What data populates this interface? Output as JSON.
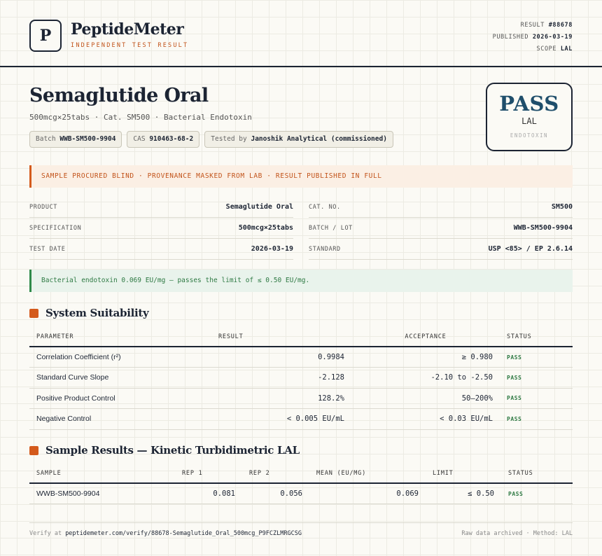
{
  "brand": {
    "logo_letter": "P",
    "name": "PeptideMeter",
    "tagline": "INDEPENDENT TEST RESULT"
  },
  "meta": {
    "result_label": "RESULT",
    "result_value": "#88678",
    "published_label": "PUBLISHED",
    "published_value": "2026-03-19",
    "scope_label": "SCOPE",
    "scope_value": "LAL"
  },
  "product": {
    "title": "Semaglutide Oral",
    "subtitle": "500mcg×25tabs · Cat. SM500 · Bacterial Endotoxin",
    "chips": [
      {
        "label": "Batch",
        "value": "WWB-SM500-9904"
      },
      {
        "label": "CAS",
        "value": "910463-68-2"
      },
      {
        "label": "Tested by",
        "value": "Janoshik Analytical (commissioned)"
      }
    ]
  },
  "verdict": {
    "main": "PASS",
    "sub": "LAL",
    "note": "ENDOTOXIN",
    "color": "#1f4e6b"
  },
  "banner": "SAMPLE PROCURED BLIND · PROVENANCE MASKED FROM LAB · RESULT PUBLISHED IN FULL",
  "specs": {
    "left": [
      {
        "key": "PRODUCT",
        "value": "Semaglutide Oral"
      },
      {
        "key": "SPECIFICATION",
        "value": "500mcg×25tabs"
      },
      {
        "key": "TEST DATE",
        "value": "2026-03-19"
      }
    ],
    "right": [
      {
        "key": "CAT. NO.",
        "value": "SM500"
      },
      {
        "key": "BATCH / LOT",
        "value": "WWB-SM500-9904"
      },
      {
        "key": "STANDARD",
        "value": "USP <85> / EP 2.6.14"
      }
    ]
  },
  "conclusion": "Bacterial endotoxin 0.069 EU/mg — passes the limit of ≤ 0.50 EU/mg.",
  "suitability": {
    "title": "System Suitability",
    "headers": [
      "PARAMETER",
      "RESULT",
      "ACCEPTANCE",
      "STATUS"
    ],
    "rows": [
      {
        "param": "Correlation Coefficient (r²)",
        "result": "0.9984",
        "acceptance": "≥ 0.980",
        "status": "PASS"
      },
      {
        "param": "Standard Curve Slope",
        "result": "-2.128",
        "acceptance": "-2.10 to -2.50",
        "status": "PASS"
      },
      {
        "param": "Positive Product Control",
        "result": "128.2%",
        "acceptance": "50–200%",
        "status": "PASS"
      },
      {
        "param": "Negative Control",
        "result": "< 0.005 EU/mL",
        "acceptance": "< 0.03 EU/mL",
        "status": "PASS"
      }
    ]
  },
  "samples": {
    "title": "Sample Results — Kinetic Turbidimetric LAL",
    "headers": [
      "SAMPLE",
      "REP 1",
      "REP 2",
      "MEAN (EU/MG)",
      "LIMIT",
      "STATUS"
    ],
    "rows": [
      {
        "sample": "WWB-SM500-9904",
        "rep1": "0.081",
        "rep2": "0.056",
        "mean": "0.069",
        "limit": "≤ 0.50",
        "status": "PASS"
      }
    ]
  },
  "footer": {
    "verify_prefix": "Verify at",
    "verify_url": "peptidemeter.com/verify/88678-Semaglutide_Oral_500mcg_P9FCZLMRGCSG",
    "right": "Raw data archived · Method: LAL"
  }
}
